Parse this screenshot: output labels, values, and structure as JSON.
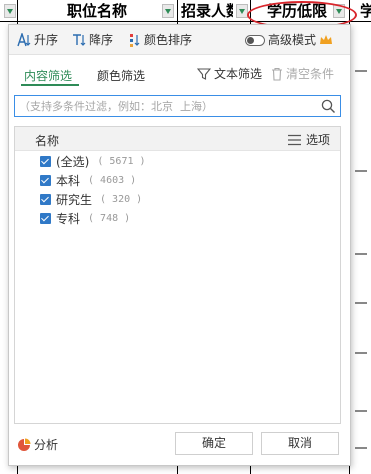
{
  "sheet": {
    "headers": [
      {
        "label": "职位名称"
      },
      {
        "label": "招录人数"
      },
      {
        "label": "学历低限"
      },
      {
        "label": "学"
      }
    ]
  },
  "toolbar": {
    "sort_asc": "升序",
    "sort_desc": "降序",
    "color_sort": "颜色排序",
    "advanced_mode": "高级模式"
  },
  "tabs": {
    "content_filter": "内容筛选",
    "color_filter": "颜色筛选",
    "text_filter": "文本筛选",
    "clear_conditions": "清空条件"
  },
  "search": {
    "placeholder": "（支持多条件过滤，例如：北京  上海）"
  },
  "list": {
    "header_name": "名称",
    "options_label": "选项",
    "items": [
      {
        "label": "(全选)",
        "count": "( 5671 )"
      },
      {
        "label": "本科",
        "count": "( 4603 )"
      },
      {
        "label": "研究生",
        "count": "( 320 )"
      },
      {
        "label": "专科",
        "count": "( 748 )"
      }
    ]
  },
  "footer": {
    "analysis": "分析",
    "confirm": "确定",
    "cancel": "取消"
  },
  "colors": {
    "accent": "#2e8b57",
    "checkbox": "#3079c7",
    "annotation": "#d9262c",
    "search_border": "#3a8ee6"
  }
}
